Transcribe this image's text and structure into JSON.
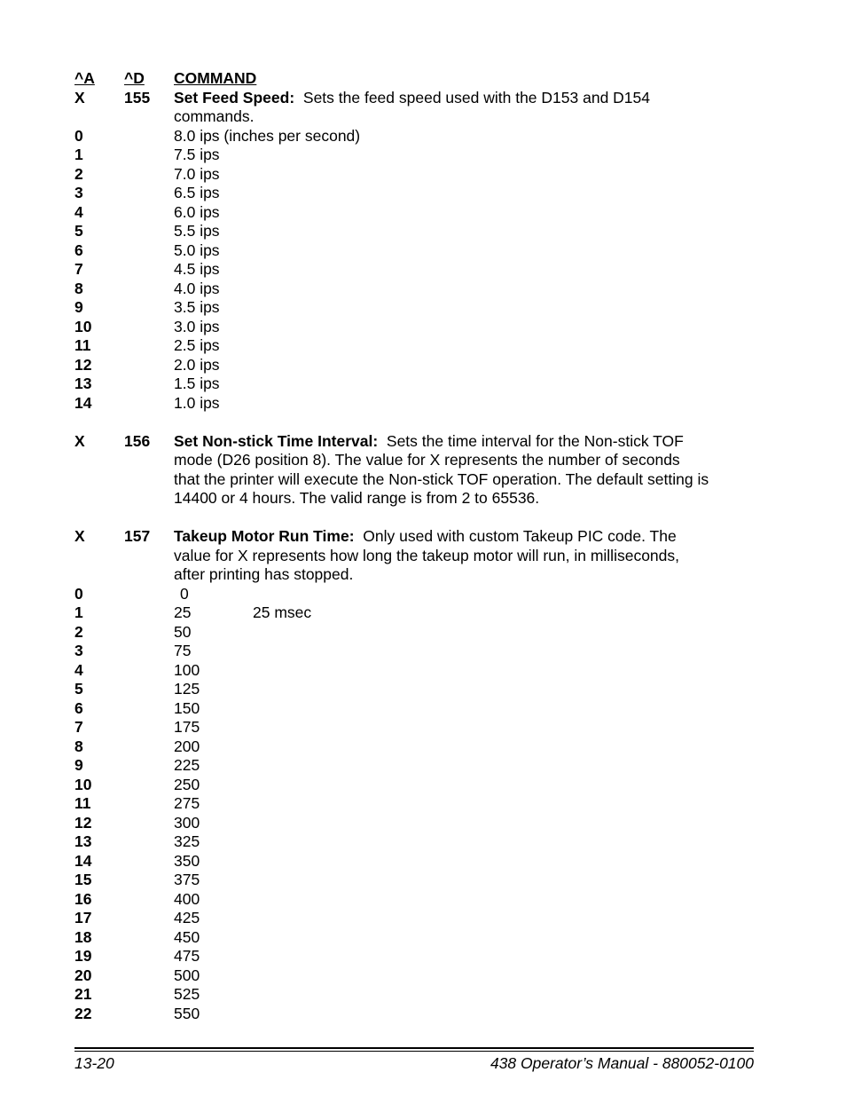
{
  "header": {
    "col_a": "^A",
    "col_d": "^D",
    "col_command": "COMMAND"
  },
  "commands": [
    {
      "a": "X",
      "d": "155",
      "title": "Set Feed Speed:",
      "desc_lines": [
        "Sets the feed speed used with the D153 and D154",
        "commands."
      ],
      "values": [
        {
          "a": "0",
          "value": "8.0 ips (inches per second)"
        },
        {
          "a": "1",
          "value": "7.5 ips"
        },
        {
          "a": "2",
          "value": "7.0 ips"
        },
        {
          "a": "3",
          "value": "6.5 ips"
        },
        {
          "a": "4",
          "value": "6.0 ips"
        },
        {
          "a": "5",
          "value": "5.5 ips"
        },
        {
          "a": "6",
          "value": "5.0 ips"
        },
        {
          "a": "7",
          "value": "4.5 ips"
        },
        {
          "a": "8",
          "value": "4.0 ips"
        },
        {
          "a": "9",
          "value": "3.5 ips"
        },
        {
          "a": "10",
          "value": "3.0 ips"
        },
        {
          "a": "11",
          "value": "2.5 ips"
        },
        {
          "a": "12",
          "value": "2.0 ips"
        },
        {
          "a": "13",
          "value": "1.5 ips"
        },
        {
          "a": "14",
          "value": "1.0 ips"
        }
      ]
    },
    {
      "a": "X",
      "d": "156",
      "title": "Set Non-stick Time Interval:",
      "desc_lines": [
        "Sets the time interval for the Non-stick TOF",
        "mode (D26 position 8).  The value for X represents the number of seconds",
        "that the printer will execute the Non-stick TOF operation.  The default setting is",
        "14400 or 4 hours.  The valid range is from 2 to 65536."
      ]
    },
    {
      "a": "X",
      "d": "157",
      "title": "Takeup Motor Run Time:",
      "desc_lines": [
        "Only used with custom Takeup PIC code.  The",
        "value for X represents how long the takeup motor will run, in milliseconds,",
        "after printing has stopped."
      ],
      "values": [
        {
          "a": "0",
          "value": "0",
          "note": ""
        },
        {
          "a": "1",
          "value": "25",
          "note": "25 msec"
        },
        {
          "a": "2",
          "value": "50",
          "note": ""
        },
        {
          "a": "3",
          "value": "75",
          "note": ""
        },
        {
          "a": "4",
          "value": "100",
          "note": ""
        },
        {
          "a": "5",
          "value": "125",
          "note": ""
        },
        {
          "a": "6",
          "value": "150",
          "note": ""
        },
        {
          "a": "7",
          "value": "175",
          "note": ""
        },
        {
          "a": "8",
          "value": "200",
          "note": ""
        },
        {
          "a": "9",
          "value": "225",
          "note": ""
        },
        {
          "a": "10",
          "value": "250",
          "note": ""
        },
        {
          "a": "11",
          "value": "275",
          "note": ""
        },
        {
          "a": "12",
          "value": "300",
          "note": ""
        },
        {
          "a": "13",
          "value": "325",
          "note": ""
        },
        {
          "a": "14",
          "value": "350",
          "note": ""
        },
        {
          "a": "15",
          "value": "375",
          "note": ""
        },
        {
          "a": "16",
          "value": "400",
          "note": ""
        },
        {
          "a": "17",
          "value": "425",
          "note": ""
        },
        {
          "a": "18",
          "value": "450",
          "note": ""
        },
        {
          "a": "19",
          "value": "475",
          "note": ""
        },
        {
          "a": "20",
          "value": "500",
          "note": ""
        },
        {
          "a": "21",
          "value": "525",
          "note": ""
        },
        {
          "a": "22",
          "value": "550",
          "note": ""
        }
      ]
    }
  ],
  "footer": {
    "page_number": "13-20",
    "manual_title": "438 Operator’s Manual - 880052-0100"
  }
}
